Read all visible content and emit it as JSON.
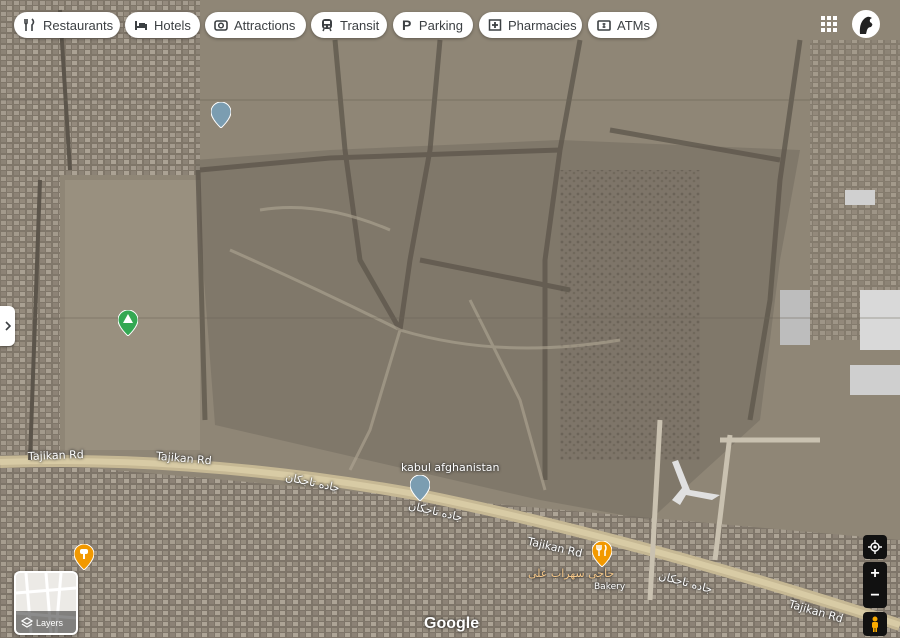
{
  "chips": [
    {
      "label": "Restaurants",
      "icon": "fork-knife-icon"
    },
    {
      "label": "Hotels",
      "icon": "bed-icon"
    },
    {
      "label": "Attractions",
      "icon": "camera-icon"
    },
    {
      "label": "Transit",
      "icon": "train-icon"
    },
    {
      "label": "Parking",
      "icon": "parking-icon"
    },
    {
      "label": "Pharmacies",
      "icon": "pharmacy-icon"
    },
    {
      "label": "ATMs",
      "icon": "atm-icon"
    }
  ],
  "map": {
    "road_labels": {
      "tajikan_1": "Tajikan Rd",
      "tajikan_2": "Tajikan Rd",
      "tajikan_3": "Tajikan Rd",
      "tajikan_4": "Tajikan Rd",
      "farsi_1": "جاده تاجکان",
      "farsi_2": "جاده تاجکان",
      "farsi_3": "جاده تاجکان"
    },
    "places": {
      "kabul": "kabul afghanistan",
      "bakery_name": "حاجی سهراب علی",
      "bakery_type": "Bakery"
    }
  },
  "controls": {
    "layers_label": "Layers",
    "attribution": "Google",
    "zoom_in": "+",
    "zoom_out": "−"
  },
  "colors": {
    "mosque_pin": "#7b9db1",
    "park_pin": "#34a853",
    "food_pin": "#f29900"
  }
}
